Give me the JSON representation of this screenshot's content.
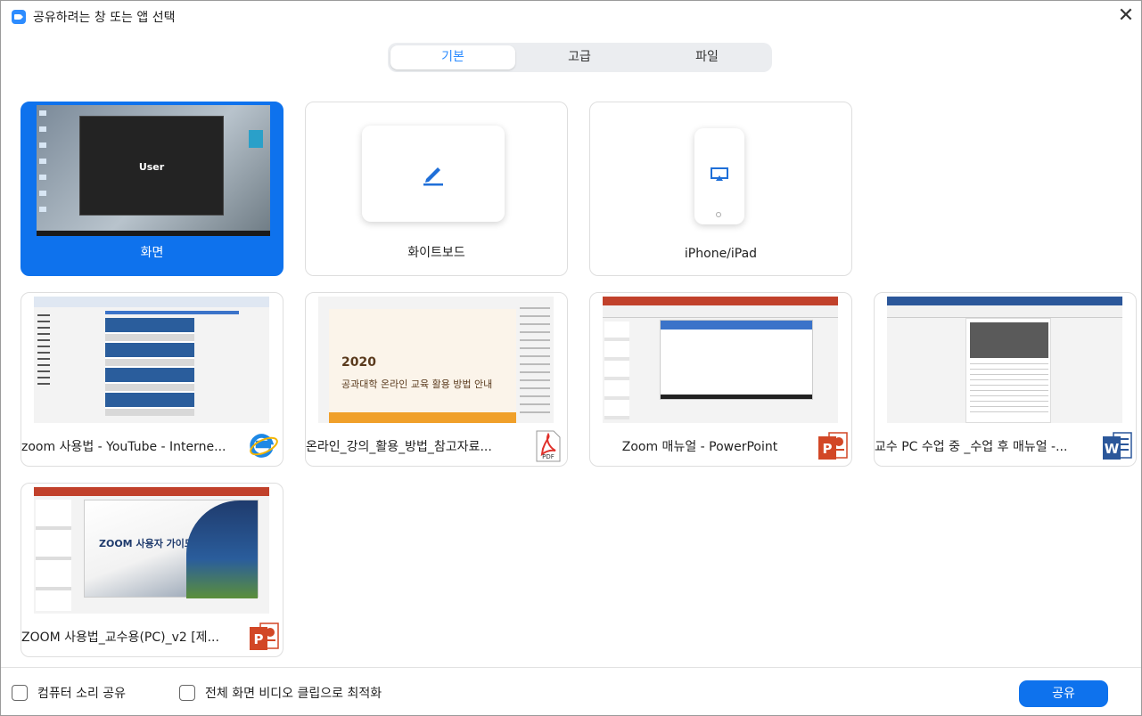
{
  "window": {
    "title": "공유하려는 창 또는 앱 선택",
    "close_glyph": "✕"
  },
  "tabs": [
    {
      "label": "기본",
      "active": true
    },
    {
      "label": "고급",
      "active": false
    },
    {
      "label": "파일",
      "active": false
    }
  ],
  "primary_sources": [
    {
      "label": "화면",
      "selected": true,
      "thumb_text": "User",
      "icon": "desktop-screenshot"
    },
    {
      "label": "화이트보드",
      "selected": false,
      "icon": "pencil-icon"
    },
    {
      "label": "iPhone/iPad",
      "selected": false,
      "icon": "airplay-icon"
    }
  ],
  "windows": [
    {
      "label": "zoom 사용법 - YouTube - Interne...",
      "app_icon": "internet-explorer-icon"
    },
    {
      "label": "온라인_강의_활용_방법_참고자료...",
      "app_icon": "pdf-icon",
      "thumb_year": "2020",
      "thumb_title": "공과대학 온라인 교육 활용 방법 안내"
    },
    {
      "label": "Zoom 매뉴얼 - PowerPoint",
      "app_icon": "powerpoint-icon"
    },
    {
      "label": "교수 PC 수업 중 _수업 후 매뉴얼 -...",
      "app_icon": "word-icon"
    },
    {
      "label": "ZOOM 사용법_교수용(PC)_v2 [제...",
      "app_icon": "powerpoint-icon",
      "thumb_title": "ZOOM 사용자 가이드"
    }
  ],
  "badges": {
    "pdf": "PDF",
    "ppt": "P",
    "word": "W"
  },
  "options": [
    {
      "label": "컴퓨터 소리 공유",
      "checked": false
    },
    {
      "label": "전체 화면 비디오 클립으로 최적화",
      "checked": false
    }
  ],
  "share_button": {
    "label": "공유"
  },
  "colors": {
    "accent": "#0e72ed",
    "tab_active_text": "#2d8cff",
    "ppt": "#d24726",
    "word": "#2b579a",
    "pdf": "#e0312b",
    "ie": "#1e88e5"
  }
}
